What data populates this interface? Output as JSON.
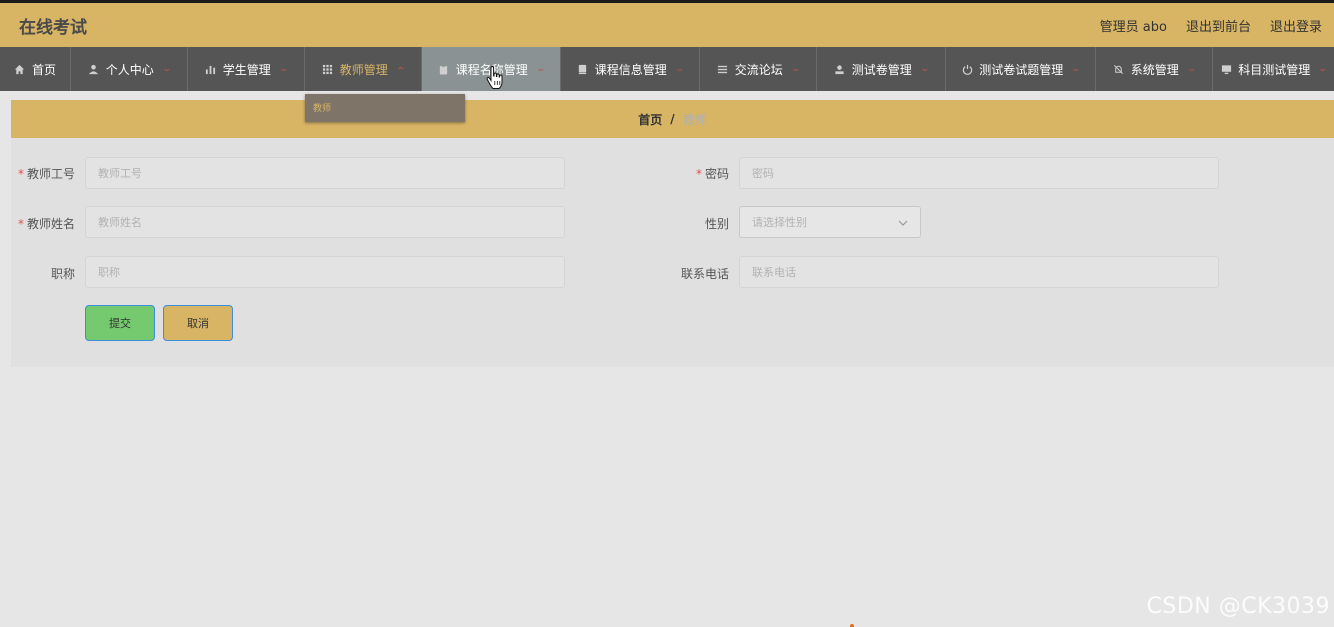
{
  "header": {
    "title": "在线考试",
    "user_label": "管理员 abo",
    "to_front_label": "退出到前台",
    "logout_label": "退出登录"
  },
  "nav": {
    "items": [
      {
        "label": "首页",
        "icon": "home-icon"
      },
      {
        "label": "个人中心",
        "icon": "user-icon"
      },
      {
        "label": "学生管理",
        "icon": "bar-chart-icon"
      },
      {
        "label": "教师管理",
        "icon": "grid-icon"
      },
      {
        "label": "课程名称管理",
        "icon": "clipboard-icon"
      },
      {
        "label": "课程信息管理",
        "icon": "book-icon"
      },
      {
        "label": "交流论坛",
        "icon": "list-icon"
      },
      {
        "label": "测试卷管理",
        "icon": "user-card-icon"
      },
      {
        "label": "测试卷试题管理",
        "icon": "power-icon"
      },
      {
        "label": "系统管理",
        "icon": "bell-off-icon"
      },
      {
        "label": "科目测试管理",
        "icon": "monitor-icon"
      }
    ],
    "dropdown_item": "教师"
  },
  "breadcrumb": {
    "home": "首页",
    "separator": "/",
    "current": "教师"
  },
  "form": {
    "teacher_id": {
      "label": "教师工号",
      "placeholder": "教师工号",
      "required": true
    },
    "password": {
      "label": "密码",
      "placeholder": "密码",
      "required": true
    },
    "teacher_name": {
      "label": "教师姓名",
      "placeholder": "教师姓名",
      "required": true
    },
    "gender": {
      "label": "性别",
      "placeholder": "请选择性别"
    },
    "title": {
      "label": "职称",
      "placeholder": "职称"
    },
    "phone": {
      "label": "联系电话",
      "placeholder": "联系电话"
    },
    "required_mark": "*",
    "submit_label": "提交",
    "cancel_label": "取消"
  },
  "watermark": "CSDN @CK3039",
  "colors": {
    "header_bg": "#d8b565",
    "nav_bg": "#555555",
    "nav_hover_bg": "#8b9293",
    "submit_bg": "#75c96e",
    "cancel_bg": "#d8b565",
    "required": "#e05050"
  }
}
